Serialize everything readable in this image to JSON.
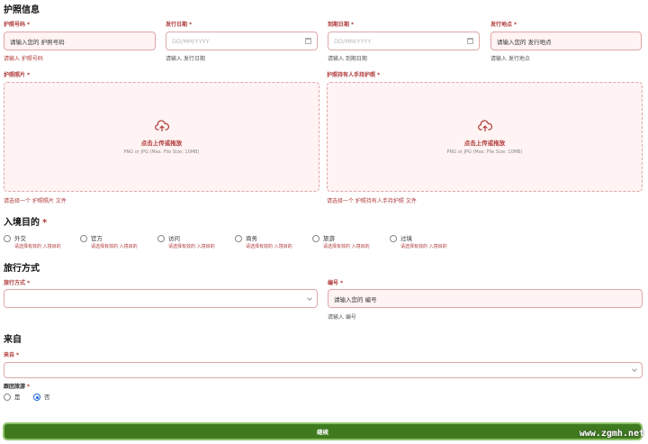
{
  "passport": {
    "title": "护照信息",
    "number": {
      "label": "护照号码",
      "placeholder": "请输入您的 护照号码",
      "hint": "请输入 护照号码"
    },
    "issue_date": {
      "label": "发行日期",
      "placeholder": "DD/MM/YYYY",
      "hint": "请输入 发行日期"
    },
    "expiry_date": {
      "label": "到期日期",
      "placeholder": "DD/MM/YYYY",
      "hint": "请输入 到期日期"
    },
    "issue_place": {
      "label": "发行地点",
      "placeholder": "请输入您的 发行地点",
      "hint": "请输入 发行地点"
    },
    "photo": {
      "label": "护照照片",
      "upload_text": "点击上传或拖放",
      "upload_sub": "PNG or JPG (Max. File Size: 10MB)",
      "hint": "请选择一个 护照照片 文件"
    },
    "holder_photo": {
      "label": "护照持有人手持护照",
      "upload_text": "点击上传或拖放",
      "upload_sub": "PNG or JPG (Max. File Size: 10MB)",
      "hint": "请选择一个 护照持有人手持护照 文件"
    }
  },
  "purpose": {
    "title": "入境目的",
    "options": [
      {
        "label": "外交",
        "sub": "请选择有效的 入境目的"
      },
      {
        "label": "官方",
        "sub": "请选择有效的 入境目的"
      },
      {
        "label": "访问",
        "sub": "请选择有效的 入境目的"
      },
      {
        "label": "商务",
        "sub": "请选择有效的 入境目的"
      },
      {
        "label": "旅游",
        "sub": "请选择有效的 入境目的"
      },
      {
        "label": "过境",
        "sub": "请选择有效的 入境目的"
      }
    ]
  },
  "travel": {
    "title": "旅行方式",
    "mode": {
      "label": "旅行方式",
      "value": ""
    },
    "number": {
      "label": "编号",
      "placeholder": "请输入您的 编号",
      "hint": "请输入 编号"
    }
  },
  "origin": {
    "title": "来自",
    "from": {
      "label": "来自",
      "value": ""
    },
    "group_tour": {
      "label": "跟团旅游",
      "yes": "是",
      "no": "否",
      "selected": "no"
    }
  },
  "continue_label": "继续",
  "watermark": "www.zgmh.net",
  "colors": {
    "accent": "#b03a3a",
    "field_bg": "#fff3f3",
    "button": "#3f7a1f"
  },
  "icons": {
    "upload": "cloud-upload-icon",
    "calendar": "calendar-icon",
    "dropdown": "chevron-down-icon"
  }
}
